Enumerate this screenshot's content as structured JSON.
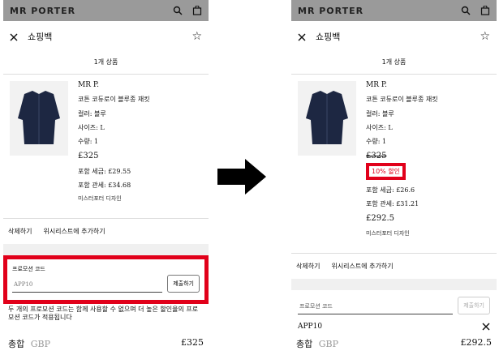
{
  "left": {
    "brand": "MR PORTER",
    "title": "쇼핑백",
    "count": "1개 상품",
    "product": {
      "brand": "MR P.",
      "name": "코튼 코듀로이 블루종 재킷",
      "color": "컬러: 블루",
      "size": "사이즈: L",
      "qty": "수량: 1",
      "price": "£325",
      "tax": "포함 세금: £29.55",
      "duty": "포함 관세: £34.68",
      "designer": "미스터포터 디자인"
    },
    "actions": {
      "remove": "삭제하기",
      "wishlist": "위시리스트에 추가하기"
    },
    "promo": {
      "label": "프로모션 코드",
      "value": "APP10",
      "submit": "제출하기",
      "note": "두 개의 프로모션 코드는 함께 사용할 수 없으며 더 높은 할인율의 프로모션 코드가 적용됩니다"
    },
    "total": {
      "label": "총합",
      "currency": "GBP",
      "amount": "£325"
    }
  },
  "right": {
    "brand": "MR PORTER",
    "title": "쇼핑백",
    "count": "1개 상품",
    "product": {
      "brand": "MR P.",
      "name": "코튼 코듀로이 블루종 재킷",
      "color": "컬러: 블루",
      "size": "사이즈: L",
      "qty": "수량: 1",
      "orig_price": "£325",
      "discount": "10% 할인",
      "tax": "포함 세금: £26.6",
      "duty": "포함 관세: £31.21",
      "new_price": "£292.5",
      "designer": "미스터포터 디자인"
    },
    "actions": {
      "remove": "삭제하기",
      "wishlist": "위시리스트에 추가하기"
    },
    "promo": {
      "label": "프로모션 코드",
      "submit": "제출하기",
      "applied": "APP10"
    },
    "total": {
      "label": "총합",
      "currency": "GBP",
      "amount": "£292.5"
    }
  },
  "colors": {
    "highlight": "#e1001a",
    "topbar": "#9a9a9a"
  }
}
